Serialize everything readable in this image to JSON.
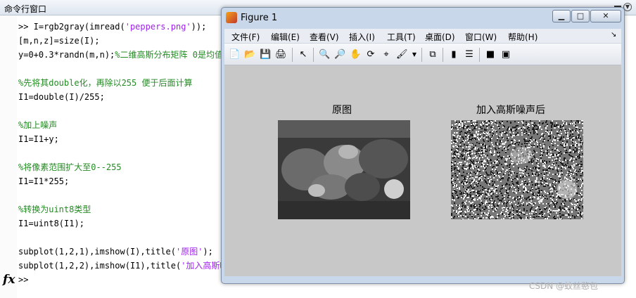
{
  "command_window": {
    "title": "命令行窗口",
    "lines": [
      {
        "parts": [
          {
            "t": ">>  I=rgb2gray(imread(",
            "c": "black"
          },
          {
            "t": "'peppers.png'",
            "c": "purple"
          },
          {
            "t": "));",
            "c": "black"
          }
        ]
      },
      {
        "parts": [
          {
            "t": "[m,n,z]=size(I);",
            "c": "black"
          }
        ]
      },
      {
        "parts": [
          {
            "t": "y=0+0.3*randn(m,n);",
            "c": "black"
          },
          {
            "t": "%二维高斯分布矩阵 0是均值",
            "c": "green"
          }
        ]
      },
      {
        "parts": []
      },
      {
        "parts": [
          {
            "t": "%先将其double化，再除以255 便于后面计算",
            "c": "green"
          }
        ]
      },
      {
        "parts": [
          {
            "t": "I1=double(I)/255;",
            "c": "black"
          }
        ]
      },
      {
        "parts": []
      },
      {
        "parts": [
          {
            "t": "%加上噪声",
            "c": "green"
          }
        ]
      },
      {
        "parts": [
          {
            "t": "I1=I1+y;",
            "c": "black"
          }
        ]
      },
      {
        "parts": []
      },
      {
        "parts": [
          {
            "t": "%将像素范围扩大至0--255",
            "c": "green"
          }
        ]
      },
      {
        "parts": [
          {
            "t": "I1=I1*255;",
            "c": "black"
          }
        ]
      },
      {
        "parts": []
      },
      {
        "parts": [
          {
            "t": "%转换为uint8类型",
            "c": "green"
          }
        ]
      },
      {
        "parts": [
          {
            "t": "I1=uint8(I1);",
            "c": "black"
          }
        ]
      },
      {
        "parts": []
      },
      {
        "parts": [
          {
            "t": "subplot(1,2,1),imshow(I),title(",
            "c": "black"
          },
          {
            "t": "'原图'",
            "c": "purple"
          },
          {
            "t": ");",
            "c": "black"
          }
        ]
      },
      {
        "parts": [
          {
            "t": "subplot(1,2,2),imshow(I1),title(",
            "c": "black"
          },
          {
            "t": "'加入高斯噪",
            "c": "purple"
          }
        ]
      }
    ],
    "fx_symbol": "fx",
    "prompt": ">>"
  },
  "figure": {
    "title": "Figure 1",
    "menu": [
      "文件(F)",
      "编辑(E)",
      "查看(V)",
      "插入(I)",
      "工具(T)",
      "桌面(D)",
      "窗口(W)",
      "帮助(H)"
    ],
    "menu_arrow": "↘",
    "toolbar_icons": [
      "new-figure-icon",
      "open-icon",
      "save-icon",
      "print-icon",
      "pointer-icon",
      "zoom-in-icon",
      "zoom-out-icon",
      "pan-icon",
      "rotate-icon",
      "data-cursor-icon",
      "brush-icon",
      "link-icon",
      "colorbar-icon",
      "legend-icon",
      "hide-tools-icon",
      "show-tools-icon"
    ],
    "subplots": [
      {
        "title": "原图",
        "image": "grayscale-peppers"
      },
      {
        "title": "加入高斯噪声后",
        "image": "noisy-grayscale-peppers"
      }
    ]
  },
  "watermark": "CSDN @蚊丝憨包",
  "colors": {
    "comment": "#228b22",
    "string": "#a020f0",
    "canvas": "#c8c8c8"
  }
}
